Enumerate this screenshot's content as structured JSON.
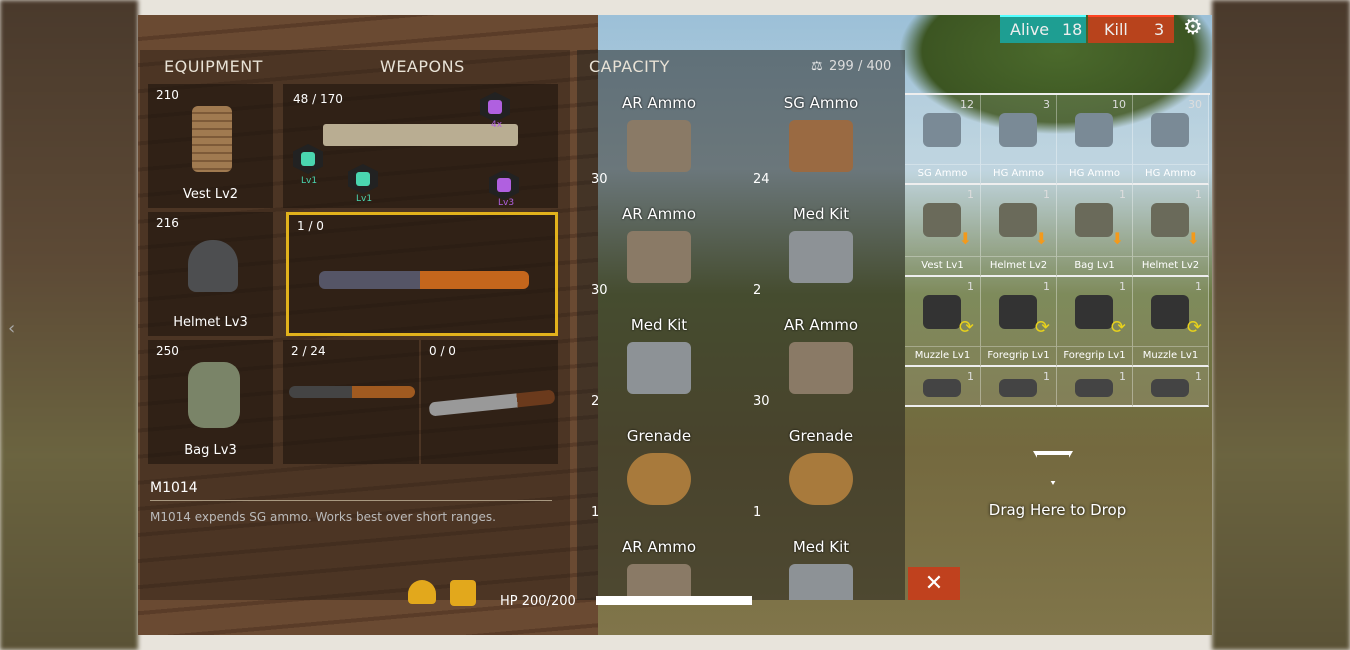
{
  "topbar": {
    "alive_label": "Alive",
    "alive_count": "18",
    "kill_label": "Kill",
    "kill_count": "3",
    "settings_icon": "gear-icon",
    "colors": {
      "alive": "#1e9e92",
      "kill": "#b8431c"
    }
  },
  "equipment": {
    "header": "EQUIPMENT",
    "slots": [
      {
        "value": "210",
        "label": "Vest Lv2"
      },
      {
        "value": "216",
        "label": "Helmet Lv3"
      },
      {
        "value": "250",
        "label": "Bag Lv3"
      }
    ]
  },
  "weapons": {
    "header": "WEAPONS",
    "slots": [
      {
        "ammo": "48 / 170",
        "attachments": [
          {
            "label": "Lv1"
          },
          {
            "label": "Lv1"
          },
          {
            "label": "4x"
          },
          {
            "label": "Lv3"
          }
        ]
      },
      {
        "ammo": "1 / 0",
        "selected": true
      },
      {
        "ammo": "2 / 24"
      },
      {
        "ammo": "0 / 0"
      }
    ]
  },
  "description": {
    "title": "M1014",
    "text": "M1014 expends SG ammo. Works best over short ranges."
  },
  "capacity": {
    "header": "CAPACITY",
    "value": "299 / 400",
    "items": [
      {
        "name": "AR Ammo",
        "qty": "30"
      },
      {
        "name": "SG Ammo",
        "qty": "24"
      },
      {
        "name": "AR Ammo",
        "qty": "30"
      },
      {
        "name": "Med Kit",
        "qty": "2"
      },
      {
        "name": "Med Kit",
        "qty": "2"
      },
      {
        "name": "AR Ammo",
        "qty": "30"
      },
      {
        "name": "Grenade",
        "qty": "1"
      },
      {
        "name": "Grenade",
        "qty": "1"
      },
      {
        "name": "AR Ammo",
        "qty": ""
      },
      {
        "name": "Med Kit",
        "qty": ""
      }
    ]
  },
  "ground": {
    "rows": [
      [
        {
          "name": "SG Ammo",
          "qty": "12"
        },
        {
          "name": "HG Ammo",
          "qty": "3"
        },
        {
          "name": "HG Ammo",
          "qty": "10"
        },
        {
          "name": "HG Ammo",
          "qty": "30"
        }
      ],
      [
        {
          "name": "Vest Lv1",
          "qty": "1"
        },
        {
          "name": "Helmet Lv2",
          "qty": "1"
        },
        {
          "name": "Bag Lv1",
          "qty": "1"
        },
        {
          "name": "Helmet Lv2",
          "qty": "1"
        }
      ],
      [
        {
          "name": "Muzzle Lv1",
          "qty": "1"
        },
        {
          "name": "Foregrip Lv1",
          "qty": "1"
        },
        {
          "name": "Foregrip Lv1",
          "qty": "1"
        },
        {
          "name": "Muzzle Lv1",
          "qty": "1"
        }
      ],
      [
        {
          "name": "",
          "qty": "1"
        },
        {
          "name": "",
          "qty": "1"
        },
        {
          "name": "",
          "qty": "1"
        },
        {
          "name": "",
          "qty": "1"
        }
      ]
    ],
    "drop_label": "Drag Here to Drop"
  },
  "hud": {
    "hp_text": "HP 200/200",
    "hp_fraction": 1.0
  }
}
